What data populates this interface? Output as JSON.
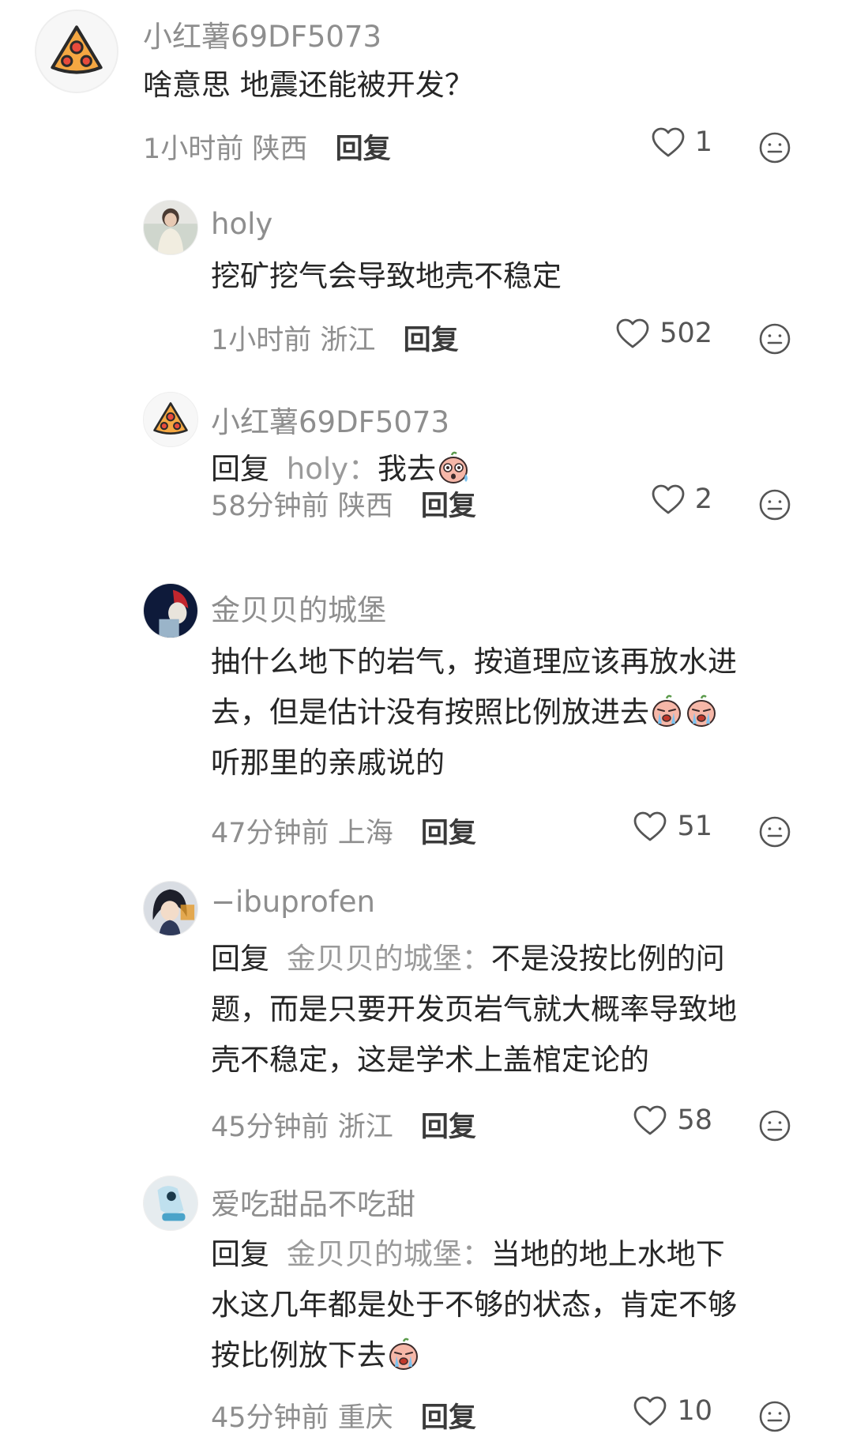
{
  "comments": [
    {
      "user": "小红薯69DF5073",
      "text": "啥意思 地震还能被开发？",
      "time": "1小时前",
      "location": "陕西",
      "reply_label": "回复",
      "likes": "1"
    },
    {
      "user": "holy",
      "text": "挖矿挖气会导致地壳不稳定",
      "time": "1小时前",
      "location": "浙江",
      "reply_label": "回复",
      "likes": "502"
    },
    {
      "user": "小红薯69DF5073",
      "reply_prefix": "回复",
      "mention": "holy",
      "sep": "：",
      "text": "我去",
      "time": "58分钟前",
      "location": "陕西",
      "reply_label": "回复",
      "likes": "2"
    },
    {
      "user": "金贝贝的城堡",
      "text_line1": "抽什么地下的岩气，按道理应该再放水进",
      "text_line2": "去，但是估计没有按照比例放进去",
      "text_line3": "听那里的亲戚说的",
      "time": "47分钟前",
      "location": "上海",
      "reply_label": "回复",
      "likes": "51"
    },
    {
      "user": "−ibuprofen",
      "reply_prefix": "回复",
      "mention": "金贝贝的城堡",
      "sep": "：",
      "text_line1": "不是没按比例的问",
      "text_line2": "题，而是只要开发页岩气就大概率导致地",
      "text_line3": "壳不稳定，这是学术上盖棺定论的",
      "time": "45分钟前",
      "location": "浙江",
      "reply_label": "回复",
      "likes": "58"
    },
    {
      "user": "爱吃甜品不吃甜",
      "reply_prefix": "回复",
      "mention": "金贝贝的城堡",
      "sep": "：",
      "text_line1": "当地的地上水地下",
      "text_line2": "水这几年都是处于不够的状态，肯定不够",
      "text_line3": "按比例放下去",
      "time": "45分钟前",
      "location": "重庆",
      "reply_label": "回复",
      "likes": "10"
    }
  ],
  "icons": {
    "like": "heart-outline-icon",
    "react": "smiley-icon",
    "emoji_surprised": "surprised-sweat-emoji",
    "emoji_crying": "crying-emoji"
  },
  "colors": {
    "muted": "#8e8e8e",
    "text": "#262626",
    "mention": "#9a9a9a"
  }
}
